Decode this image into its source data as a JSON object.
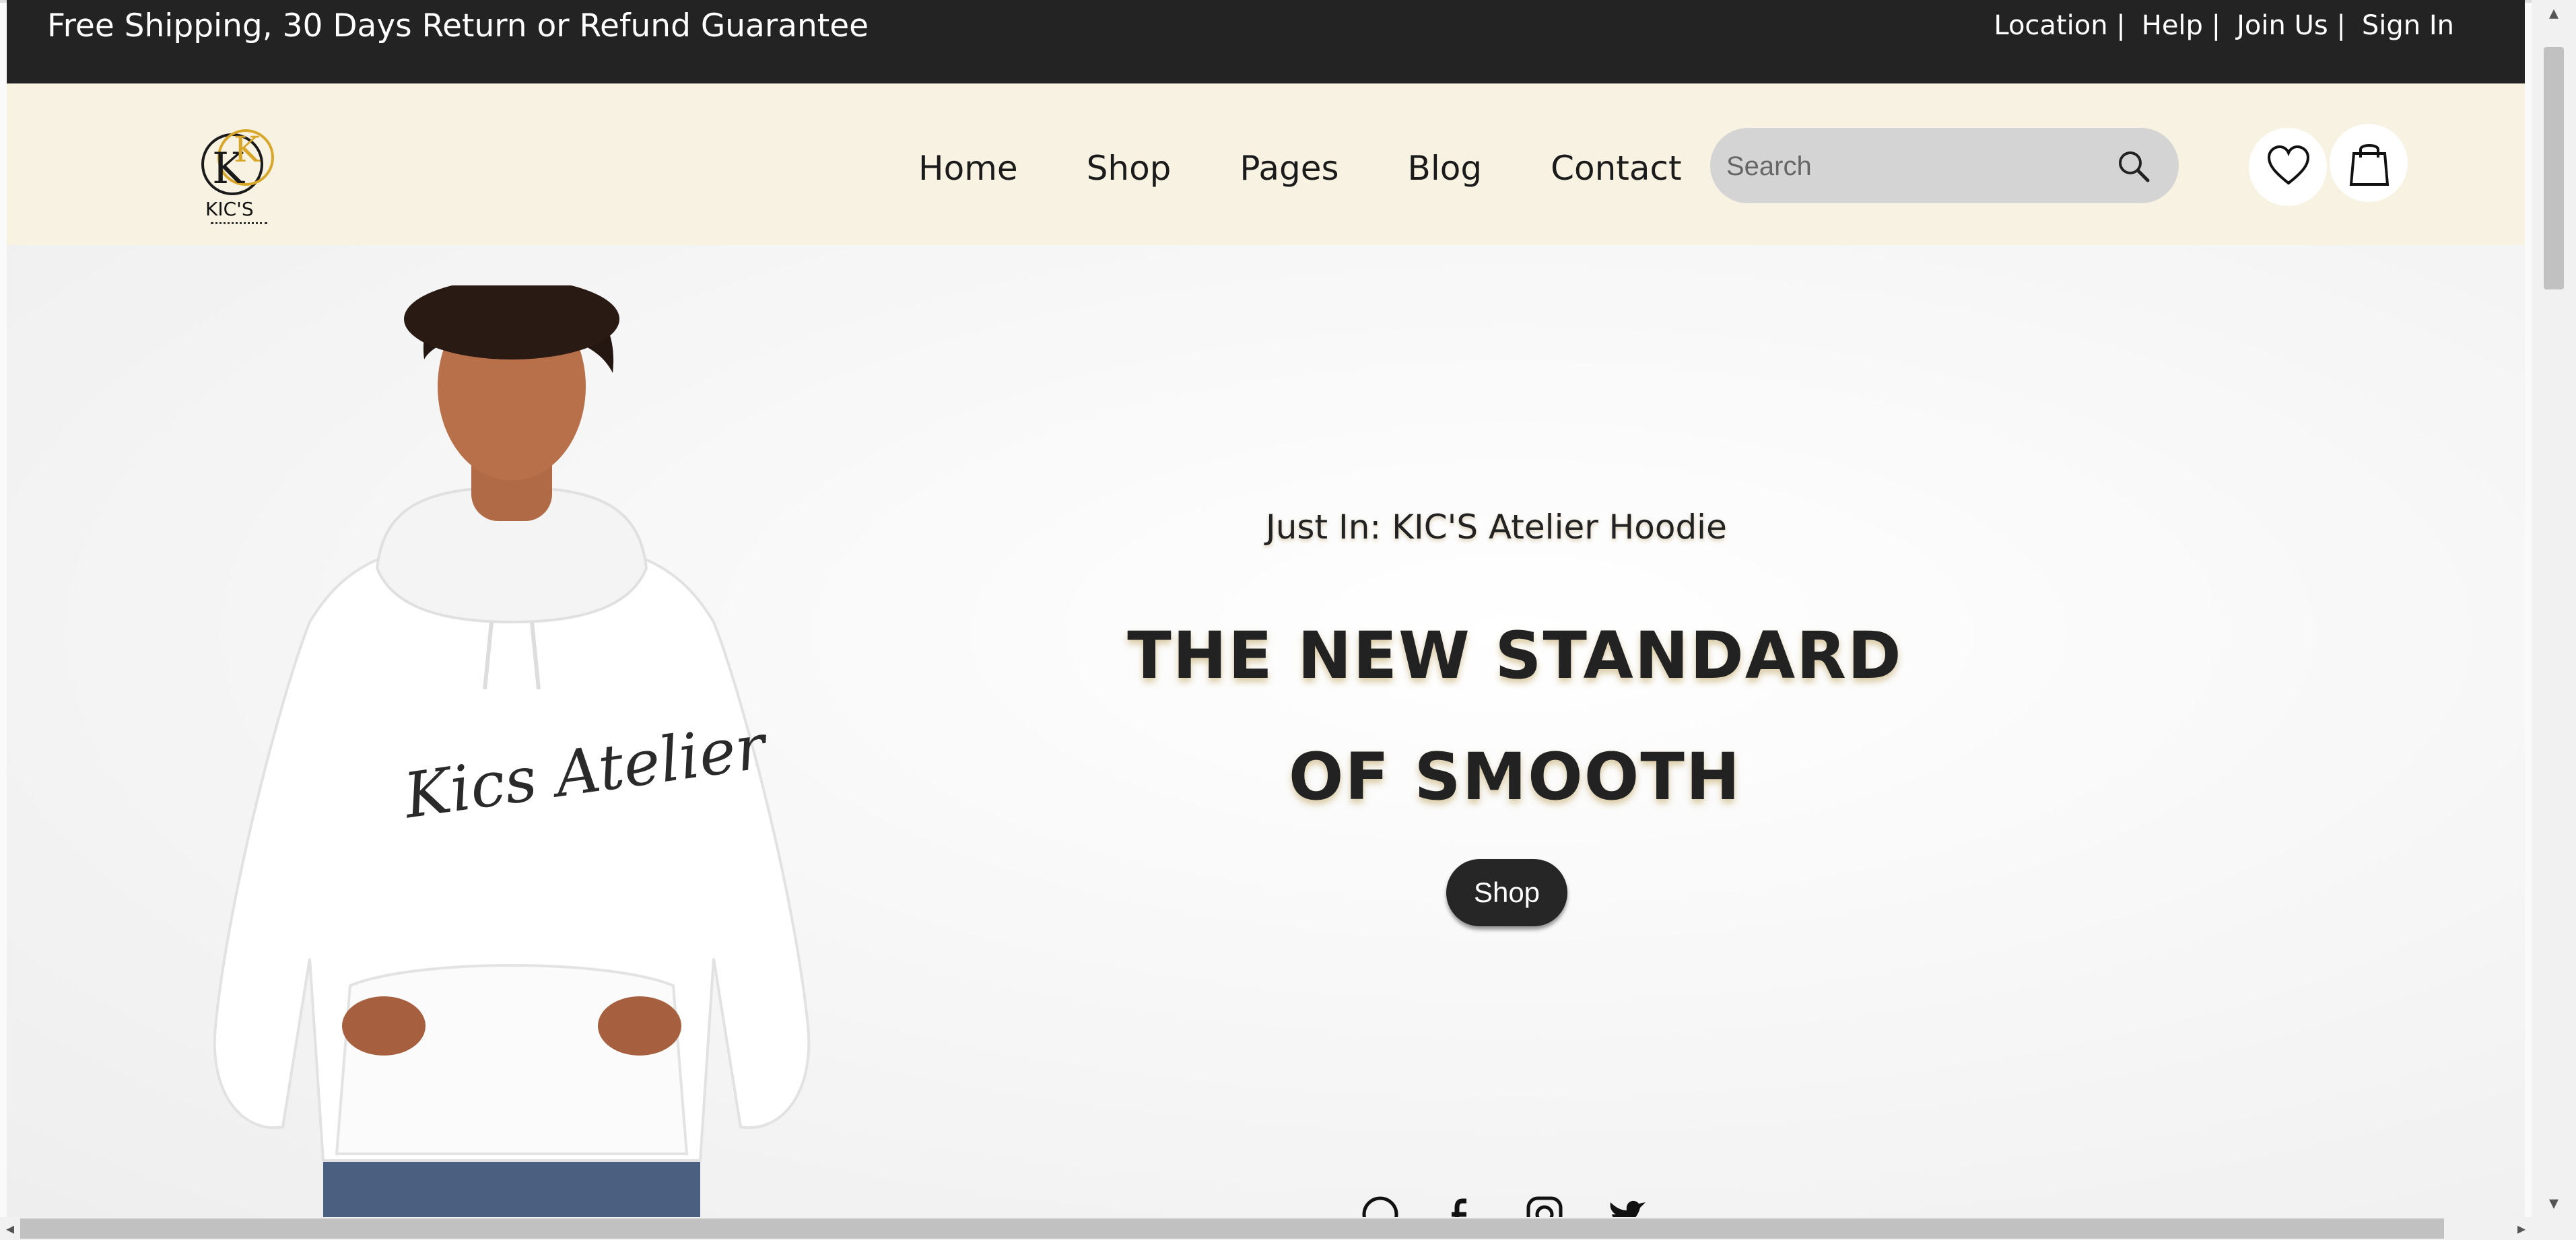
{
  "topbar": {
    "promo": "Free Shipping, 30 Days Return or Refund Guarantee",
    "links": [
      "Location |",
      "Help |",
      "Join Us |",
      "Sign In"
    ]
  },
  "header": {
    "logo_text": "KIC'S",
    "nav": [
      "Home",
      "Shop",
      "Pages",
      "Blog",
      "Contact"
    ],
    "search_placeholder": "Search"
  },
  "hero": {
    "subheading": "Just In: KIC'S Atelier Hoodie",
    "headline_line1": "THE NEW STANDARD",
    "headline_line2": "OF SMOOTH",
    "button_label": "Shop",
    "hoodie_print": "Kics Atelier"
  },
  "socials": [
    "whatsapp-icon",
    "facebook-icon",
    "instagram-icon",
    "twitter-icon"
  ],
  "colors": {
    "topbar": "#232323",
    "header": "#f8f2e2",
    "gold": "#d8a72a"
  }
}
